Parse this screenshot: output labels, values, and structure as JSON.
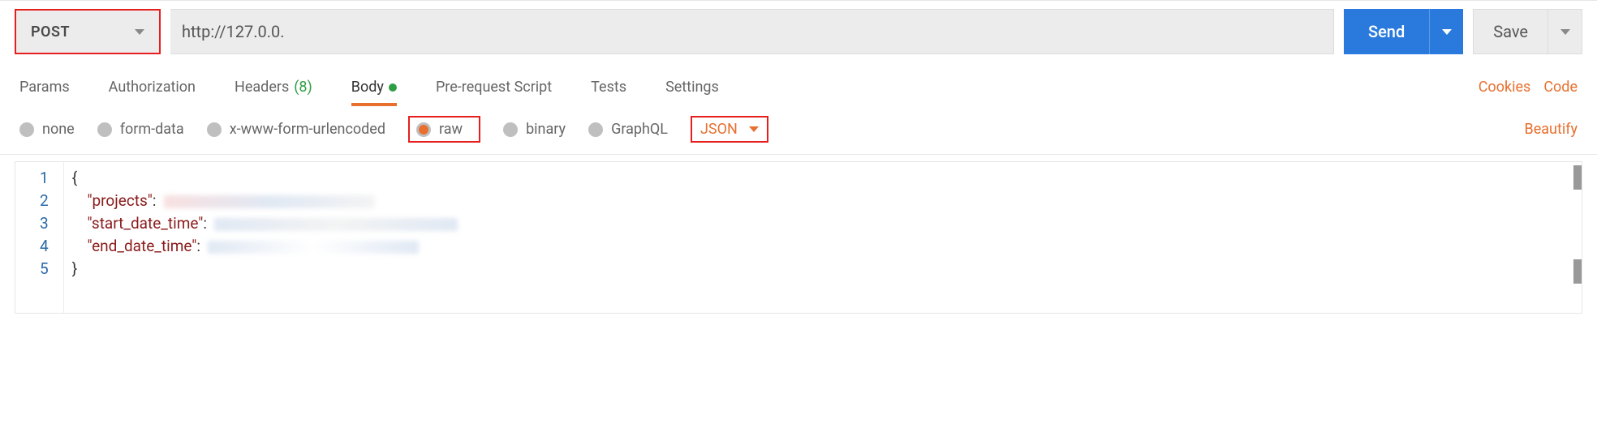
{
  "request": {
    "method": "POST",
    "url": "http://127.0.0."
  },
  "actions": {
    "send": "Send",
    "save": "Save"
  },
  "tabs": [
    {
      "label": "Params"
    },
    {
      "label": "Authorization"
    },
    {
      "label": "Headers",
      "count": "(8)"
    },
    {
      "label": "Body",
      "active": true,
      "indicator": true
    },
    {
      "label": "Pre-request Script"
    },
    {
      "label": "Tests"
    },
    {
      "label": "Settings"
    }
  ],
  "tab_links": {
    "cookies": "Cookies",
    "code": "Code"
  },
  "body_options": {
    "none": "none",
    "form_data": "form-data",
    "urlencoded": "x-www-form-urlencoded",
    "raw": "raw",
    "binary": "binary",
    "graphql": "GraphQL",
    "format": "JSON",
    "beautify": "Beautify",
    "selected": "raw"
  },
  "editor": {
    "lines": [
      "1",
      "2",
      "3",
      "4",
      "5"
    ],
    "content": {
      "open": "{",
      "key1": "\"projects\"",
      "key2": "\"start_date_time\"",
      "key3": "\"end_date_time\"",
      "close": "}"
    }
  }
}
